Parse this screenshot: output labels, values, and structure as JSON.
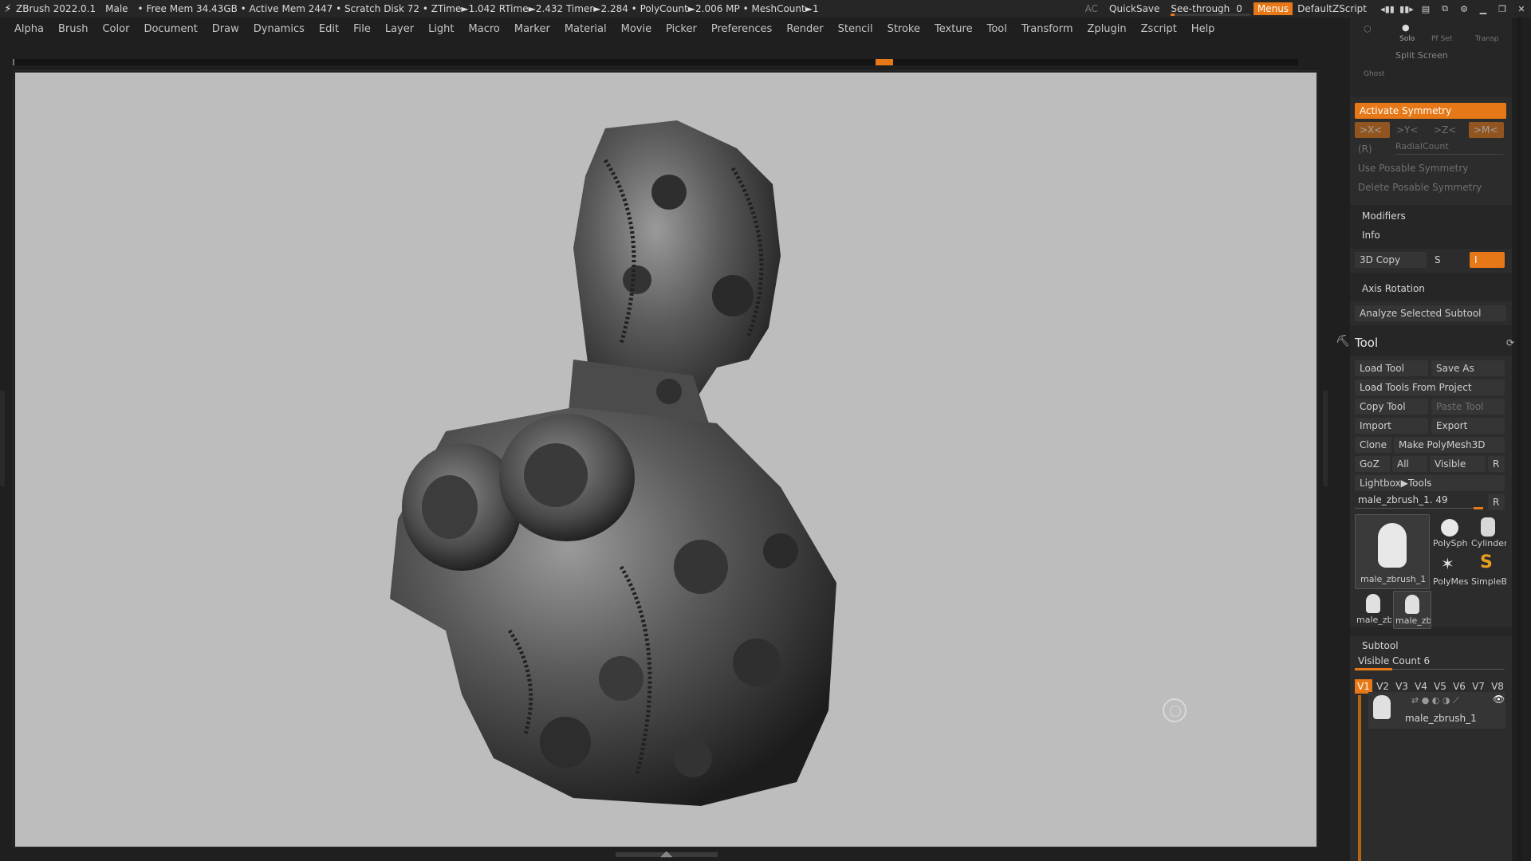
{
  "titlebar": {
    "app": "ZBrush 2022.0.1",
    "model": "Male",
    "stats": "• Free Mem 34.43GB • Active Mem 2447 • Scratch Disk 72 •  ZTime►1.042 RTime►2.432 Timer►2.284 • PolyCount►2.006 MP  • MeshCount►1",
    "ac": "AC",
    "quicksave": "QuickSave",
    "seethrough_label": "See-through",
    "seethrough_value": "0",
    "seethrough_fraction": 0.05,
    "menus": "Menus",
    "script": "DefaultZScript"
  },
  "menubar": [
    "Alpha",
    "Brush",
    "Color",
    "Document",
    "Draw",
    "Dynamics",
    "Edit",
    "File",
    "Layer",
    "Light",
    "Macro",
    "Marker",
    "Material",
    "Movie",
    "Picker",
    "Preferences",
    "Render",
    "Stencil",
    "Stroke",
    "Texture",
    "Tool",
    "Transform",
    "Zplugin",
    "Zscript",
    "Help"
  ],
  "panel": {
    "top_icons": {
      "solo": "Solo",
      "polyf": "Pf Set",
      "transp": "Transp",
      "ghost": "Ghost",
      "split_screen": "Split Screen"
    },
    "symmetry": {
      "activate": "Activate Symmetry",
      "x": ">X<",
      "y": ">Y<",
      "z": ">Z<",
      "m": ">M<",
      "r": "(R)",
      "radial": "RadialCount",
      "use_posable": "Use Posable Symmetry",
      "delete_posable": "Delete Posable Symmetry"
    },
    "modifiers": "Modifiers",
    "info": "Info",
    "copy3d": "3D Copy",
    "copy_s": "S",
    "copy_i": "I",
    "axis_rotation": "Axis Rotation",
    "analyze": "Analyze Selected Subtool",
    "tool": {
      "title": "Tool",
      "load_tool": "Load Tool",
      "save_as": "Save As",
      "load_from_project": "Load Tools From Project",
      "copy_tool": "Copy Tool",
      "paste_tool": "Paste Tool",
      "import": "Import",
      "export": "Export",
      "clone": "Clone",
      "make_polymesh": "Make PolyMesh3D",
      "goz": "GoZ",
      "all": "All",
      "visible": "Visible",
      "r": "R",
      "lightbox": "Lightbox▶Tools",
      "current_tool": "male_zbrush_1. 49",
      "current_r": "R",
      "thumbs": {
        "main": "male_zbrush_1",
        "polysphere": "PolySph",
        "cylinder": "Cylinder",
        "polymesh": "PolyMes",
        "simplebrush": "SimpleB",
        "small1": "male_zb",
        "small2": "male_zb"
      }
    },
    "subtool": {
      "title": "Subtool",
      "visible_count": "Visible Count 6",
      "visible_fraction": 0.25,
      "tabs": [
        "V1",
        "V2",
        "V3",
        "V4",
        "V5",
        "V6",
        "V7",
        "V8"
      ],
      "active_tab": "V1",
      "item_name": "male_zbrush_1"
    }
  },
  "colors": {
    "accent": "#e77817",
    "panel": "#262626",
    "canvas": "#bdbdbd",
    "button": "#353535"
  }
}
